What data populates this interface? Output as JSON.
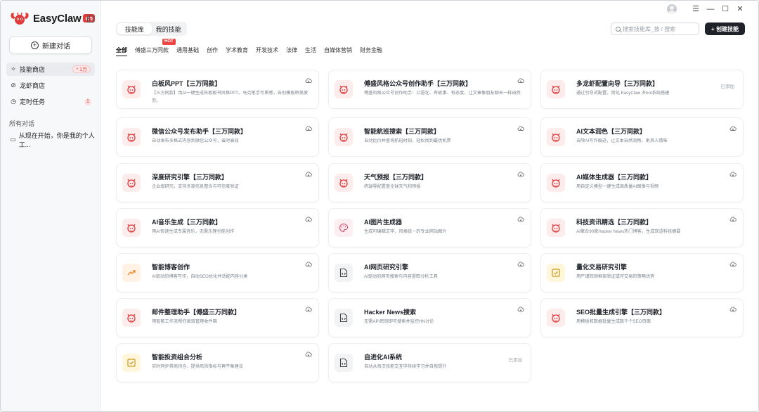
{
  "app": {
    "name": "EasyClaw",
    "tag": "cn"
  },
  "sidebar": {
    "new_chat": "新建对话",
    "items": [
      {
        "label": "技能商店",
        "badge": "* 1万",
        "icon": "sparkle-icon"
      },
      {
        "label": "龙虾商店",
        "icon": "link-icon"
      },
      {
        "label": "定时任务",
        "count": "1",
        "icon": "clock-icon"
      }
    ],
    "section_label": "所有对话",
    "conversations": [
      {
        "label": "从现在开始，你是我的个人工...",
        "icon": "chat-icon"
      }
    ]
  },
  "header": {
    "tabs": [
      "技能库",
      "我的技能"
    ],
    "search_placeholder": "搜索技能库_按 / 搜索",
    "create_label": "+ 创建技能"
  },
  "categories": [
    "全部",
    "傅盛三万同款",
    "通用基础",
    "创作",
    "学术教育",
    "开发技术",
    "法律",
    "生活",
    "自媒体营销",
    "财务金融"
  ],
  "hot_label": "HOT",
  "added_label": "已添加",
  "skills": [
    {
      "title": "白板风PPT【三万同款】",
      "desc": "【三万同款】用AI一键生成白板板书风格PPT。马克笔手写质感，告别模板审美疲劳。",
      "icon": "lobster-icon",
      "color": "red",
      "added": false
    },
    {
      "title": "傅盛风格公众号创作助手【三万同款】",
      "desc": "傅盛风格公众号创作助手：口语化、有故事、有态度，让文章像朋友聊天一样自然",
      "icon": "lobster-icon",
      "color": "red",
      "added": false
    },
    {
      "title": "多龙虾配置向导【三万同款】",
      "desc": "通过引导式配置，简化 EasyClaw 多bot系统搭建",
      "icon": "lobster-icon",
      "color": "red",
      "added": true
    },
    {
      "title": "微信公众号发布助手【三万同款】",
      "desc": "自动发布多格式内容到微信公众号，省时高效",
      "icon": "lobster-icon",
      "color": "red",
      "added": false
    },
    {
      "title": "智能航班搜索【三万同款】",
      "desc": "自动比价并查询航班时刻，轻松找到最优机票",
      "icon": "lobster-icon",
      "color": "red",
      "added": false
    },
    {
      "title": "AI文本润色【三万同款】",
      "desc": "去除AI写作痕迹，让文本自然流畅、更具人情味",
      "icon": "lobster-icon",
      "color": "red",
      "added": false
    },
    {
      "title": "深度研究引擎【三万同款】",
      "desc": "企业级研究，支持多源信息整合与可信度验证",
      "icon": "lobster-icon",
      "color": "red",
      "added": false
    },
    {
      "title": "天气预报【三万同款】",
      "desc": "终端零配置查全球天气和预报",
      "icon": "lobster-icon",
      "color": "red",
      "added": false
    },
    {
      "title": "AI媒体生成器【三万同款】",
      "desc": "用自定义模型一键生成高质量AI图像与视频",
      "icon": "lobster-icon",
      "color": "red",
      "added": false
    },
    {
      "title": "AI音乐生成【三万同款】",
      "desc": "用AI快速生成专属音乐，无需乐理也能创作",
      "icon": "lobster-icon",
      "color": "red",
      "added": false
    },
    {
      "title": "AI图片生成器",
      "desc": "生成可编辑文字、风格统一的专业网站图片",
      "icon": "palette-icon",
      "color": "pink",
      "added": false
    },
    {
      "title": "科技资讯精选【三万同款】",
      "desc": "AI聚合90家Hacker News热门博客，生成双语科技摘要",
      "icon": "lobster-icon",
      "color": "red",
      "added": false
    },
    {
      "title": "智能博客创作",
      "desc": "AI驱动的博客写作，自动SEO优化并适配内容分类",
      "icon": "trend-icon",
      "color": "orange",
      "added": false
    },
    {
      "title": "AI网页研究引擎",
      "desc": "AI驱动的网页搜索与内容提取分析工具",
      "icon": "code-file-icon",
      "color": "gray",
      "added": false
    },
    {
      "title": "量化交易研究引擎",
      "desc": "用严谨回测框架验证或可交易的策略优势",
      "icon": "check-box-icon",
      "color": "yellow",
      "added": false
    },
    {
      "title": "邮件整理助手【傅盛三万同款】",
      "desc": "用智能工作流帮你高效管理收件箱",
      "icon": "lobster-icon",
      "color": "red",
      "added": false
    },
    {
      "title": "Hacker News搜索",
      "desc": "无需API密钥即可搜索并监控HN讨论",
      "icon": "code-file-icon",
      "color": "gray",
      "added": false
    },
    {
      "title": "SEO批量生成引擎【三万同款】",
      "desc": "用模板和数据批量生成数千个SEO页面",
      "icon": "lobster-icon",
      "color": "red",
      "added": false
    },
    {
      "title": "智能投资组合分析",
      "desc": "实时同步券商持仓，提供风险指标与再平衡建议",
      "icon": "check-box-icon",
      "color": "yellow",
      "added": false
    },
    {
      "title": "自进化AI系统",
      "desc": "自动从每次技能交互中持续学习并自我提升",
      "icon": "code-file-icon",
      "color": "gray",
      "added": true
    }
  ]
}
